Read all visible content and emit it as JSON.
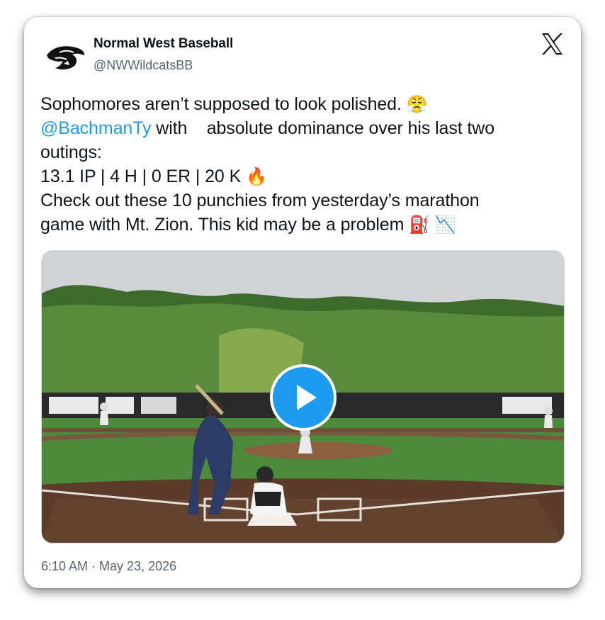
{
  "author": {
    "name": "Normal West Baseball",
    "handle": "@NWWildcatsBB"
  },
  "tweet": {
    "line1_text": "Sophomores aren’t supposed to look polished.",
    "line1_emoji": "😤",
    "mention": "@BachmanTy",
    "line2_text": "with    absolute dominance over his last two",
    "line3_text": "outings:",
    "line4_text": "13.1 IP | 4 H | 0 ER | 20 K",
    "line4_emoji": "🔥",
    "line5_text": "Check out these 10 punchies from yesterday’s marathon",
    "line6_text": "game with Mt. Zion. This kid may be a problem",
    "line6_emoji1": "⛽",
    "line6_emoji2": "📉"
  },
  "media": {
    "type": "video",
    "play_icon": "play-icon"
  },
  "timestamp": "6:10 AM · May 23, 2026",
  "icons": {
    "brand": "x-logo-icon",
    "avatar": "wildcat-logo-icon"
  },
  "colors": {
    "link": "#1d9bf0",
    "text": "#0f1419",
    "secondary_text": "#536471",
    "play_button": "#1d9bf0"
  }
}
